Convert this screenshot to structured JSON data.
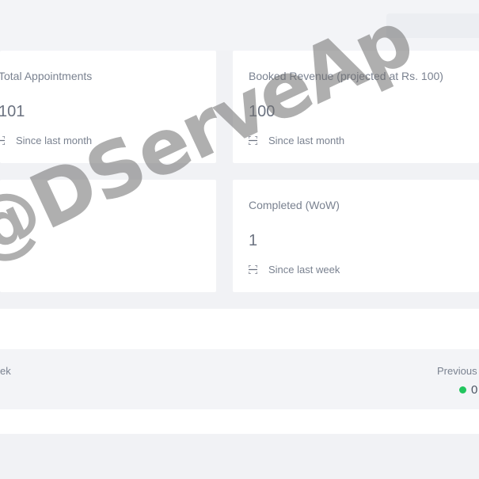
{
  "cards": [
    {
      "title": "Total Appointments",
      "value": "101",
      "sub": "Since last month"
    },
    {
      "title": "Booked Revenue (projected at Rs. 100)",
      "value": "100",
      "sub": "Since last month"
    },
    {
      "title": "",
      "value": "",
      "sub": ""
    },
    {
      "title": "Completed (WoW)",
      "value": "1",
      "sub": "Since last week"
    }
  ],
  "panel": {
    "left_label": "ek",
    "right_label": "Previous W",
    "right_value": "0",
    "status_color": "#22c55e"
  },
  "watermark": {
    "text": "@DServeAp"
  }
}
